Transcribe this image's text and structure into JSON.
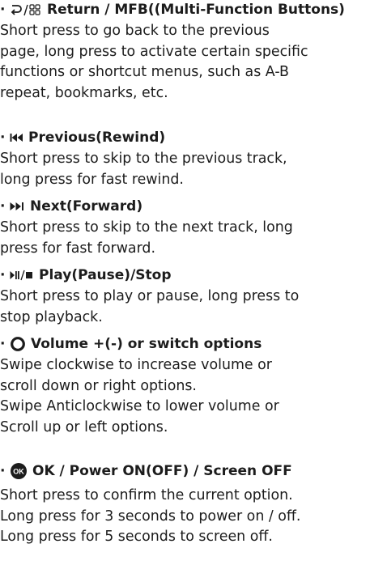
{
  "bullet": "·",
  "entries": [
    {
      "icon": "return-mfb-icon",
      "title": "Return / MFB((Multi-Function Buttons)",
      "lines": [
        "Short press to go back to the previous",
        "page, long press to activate certain specific",
        "functions or shortcut menus, such as A-B",
        "repeat, bookmarks, etc."
      ]
    },
    {
      "icon": "previous-track-icon",
      "title": "Previous(Rewind)",
      "lines": [
        "Short press to skip to the previous track,",
        "long press for fast rewind."
      ]
    },
    {
      "icon": "next-track-icon",
      "title": "Next(Forward)",
      "lines": [
        "Short press to skip to the next track, long",
        "press for fast forward."
      ]
    },
    {
      "icon": "play-pause-stop-icon",
      "title": "Play(Pause)/Stop",
      "lines": [
        "Short press to play or pause, long press to",
        "stop playback."
      ]
    },
    {
      "icon": "volume-wheel-icon",
      "title": "Volume +(-) or switch options",
      "lines": [
        "Swipe clockwise to increase volume or",
        "scroll down or right options.",
        "Swipe Anticlockwise to lower volume or",
        "Scroll up or left options."
      ]
    },
    {
      "icon": "ok-button-icon",
      "icon_text": "OK",
      "title": "OK / Power ON(OFF) / Screen OFF",
      "lines": [
        "Short press to confirm the current option.",
        "Long press for 3 seconds to power on / off.",
        "Long press for 5 seconds to screen off."
      ]
    }
  ]
}
